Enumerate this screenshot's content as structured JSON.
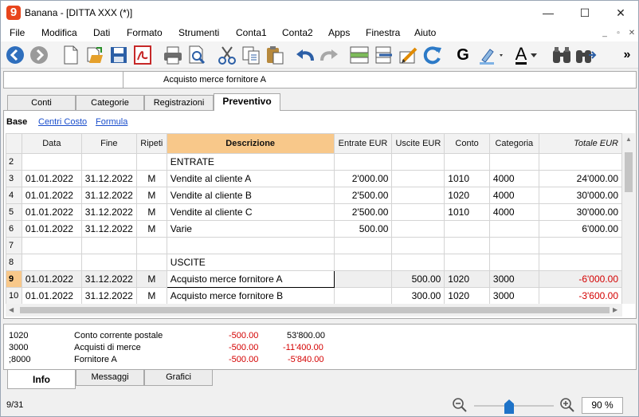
{
  "window": {
    "title": "Banana - [DITTA XXX (*)]",
    "logo": "9",
    "min": "—",
    "max": "☐",
    "close": "✕"
  },
  "menu": [
    "File",
    "Modifica",
    "Dati",
    "Formato",
    "Strumenti",
    "Conta1",
    "Conta2",
    "Apps",
    "Finestra",
    "Aiuto"
  ],
  "mdi": [
    "_",
    "▫",
    "✕"
  ],
  "toolbar": {
    "icons": [
      "back-icon",
      "forward-icon",
      "new-file-icon",
      "open-folder-icon",
      "save-icon",
      "pdf-icon",
      "print-icon",
      "print-preview-icon",
      "cut-icon",
      "copy-icon",
      "paste-icon",
      "undo-icon",
      "redo-icon",
      "insert-rows-icon",
      "delete-rows-icon",
      "edit-cell-icon",
      "recalculate-icon",
      "bold-icon",
      "highlight-icon",
      "font-color-icon",
      "find-icon",
      "find-next-icon",
      "overflow-icon"
    ],
    "bold_label": "G",
    "font_color_label": "A",
    "overflow_label": "»"
  },
  "cellbar": {
    "reference": "",
    "content": "Acquisto merce fornitore A"
  },
  "tabs": [
    "Conti",
    "Categorie",
    "Registrazioni",
    "Preventivo"
  ],
  "views": [
    "Base",
    "Centri Costo",
    "Formula"
  ],
  "grid": {
    "columns": [
      "",
      "Data",
      "Fine",
      "Ripeti",
      "Descrizione",
      "Entrate EUR",
      "Uscite EUR",
      "Conto",
      "Categoria",
      "Totale EUR"
    ],
    "rows": [
      {
        "n": "2",
        "data": "",
        "fine": "",
        "ripeti": "",
        "desc": "ENTRATE",
        "entrate": "",
        "uscite": "",
        "conto": "",
        "categoria": "",
        "totale": "",
        "bold": true,
        "neg": false
      },
      {
        "n": "3",
        "data": "01.01.2022",
        "fine": "31.12.2022",
        "ripeti": "M",
        "desc": "Vendite al cliente A",
        "entrate": "2'000.00",
        "uscite": "",
        "conto": "1010",
        "categoria": "4000",
        "totale": "24'000.00",
        "bold": false,
        "neg": false
      },
      {
        "n": "4",
        "data": "01.01.2022",
        "fine": "31.12.2022",
        "ripeti": "M",
        "desc": "Vendite al cliente B",
        "entrate": "2'500.00",
        "uscite": "",
        "conto": "1020",
        "categoria": "4000",
        "totale": "30'000.00",
        "bold": false,
        "neg": false
      },
      {
        "n": "5",
        "data": "01.01.2022",
        "fine": "31.12.2022",
        "ripeti": "M",
        "desc": "Vendite al cliente C",
        "entrate": "2'500.00",
        "uscite": "",
        "conto": "1010",
        "categoria": "4000",
        "totale": "30'000.00",
        "bold": false,
        "neg": false
      },
      {
        "n": "6",
        "data": "01.01.2022",
        "fine": "31.12.2022",
        "ripeti": "M",
        "desc": "Varie",
        "entrate": "500.00",
        "uscite": "",
        "conto": "",
        "categoria": "",
        "totale": "6'000.00",
        "bold": false,
        "neg": false
      },
      {
        "n": "7",
        "data": "",
        "fine": "",
        "ripeti": "",
        "desc": "",
        "entrate": "",
        "uscite": "",
        "conto": "",
        "categoria": "",
        "totale": "",
        "bold": false,
        "neg": false
      },
      {
        "n": "8",
        "data": "",
        "fine": "",
        "ripeti": "",
        "desc": "USCITE",
        "entrate": "",
        "uscite": "",
        "conto": "",
        "categoria": "",
        "totale": "",
        "bold": true,
        "neg": false
      },
      {
        "n": "9",
        "data": "01.01.2022",
        "fine": "31.12.2022",
        "ripeti": "M",
        "desc": "Acquisto merce fornitore A",
        "entrate": "",
        "uscite": "500.00",
        "conto": "1020",
        "categoria": "3000",
        "totale": "-6'000.00",
        "bold": false,
        "neg": true,
        "selected": true
      },
      {
        "n": "10",
        "data": "01.01.2022",
        "fine": "31.12.2022",
        "ripeti": "M",
        "desc": "Acquisto merce fornitore B",
        "entrate": "",
        "uscite": "300.00",
        "conto": "1020",
        "categoria": "3000",
        "totale": "-3'600.00",
        "bold": false,
        "neg": true
      }
    ]
  },
  "info": [
    {
      "code": "1020",
      "name": "Conto corrente postale",
      "amount": "-500.00",
      "balance": "53'800.00",
      "balance_neg": false
    },
    {
      "code": "3000",
      "name": "Acquisti di merce",
      "amount": "-500.00",
      "balance": "-11'400.00",
      "balance_neg": true
    },
    {
      "code": ";8000",
      "name": "Fornitore A",
      "amount": "-500.00",
      "balance": "-5'840.00",
      "balance_neg": true
    }
  ],
  "bottom_tabs": [
    "Info",
    "Messaggi",
    "Grafici"
  ],
  "status": {
    "position": "9/31",
    "zoom": "90 %",
    "zoom_level_percent": 90
  },
  "colors": {
    "header_highlight": "#f8c88a",
    "negative": "#d40000",
    "link": "#1a4ecc",
    "accent_blue": "#1e73c8"
  }
}
